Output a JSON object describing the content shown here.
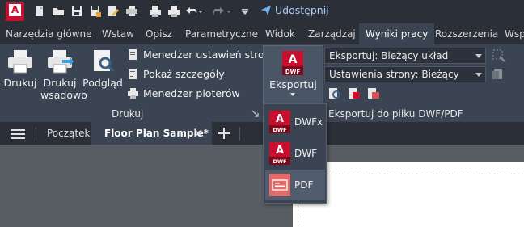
{
  "qat": {
    "share_label": "Udostępnij"
  },
  "tabs": [
    {
      "label": "Narzędzia główne",
      "active": false
    },
    {
      "label": "Wstaw",
      "active": false
    },
    {
      "label": "Opisz",
      "active": false
    },
    {
      "label": "Parametryczne",
      "active": false
    },
    {
      "label": "Widok",
      "active": false
    },
    {
      "label": "Zarządzaj",
      "active": false
    },
    {
      "label": "Wyniki pracy",
      "active": true
    },
    {
      "label": "Rozszerzenia",
      "active": false
    },
    {
      "label": "Wsp",
      "active": false
    }
  ],
  "ribbon": {
    "print_group": {
      "label": "Drukuj",
      "plot": "Drukuj",
      "batch_plot_line1": "Drukuj",
      "batch_plot_line2": "wsadowo",
      "preview": "Podgląd",
      "page_setup_manager": "Menedżer ustawień strony",
      "plot_details": "Pokaż szczegóły",
      "plotter_manager": "Menedżer ploterów"
    },
    "export_group": {
      "button_label": "Eksportuj",
      "export_combo_value": "Eksportuj: Bieżący układ",
      "page_setup_combo_value": "Ustawienia strony: Bieżący",
      "group_label": "Eksportuj do pliku DWF/PDF"
    }
  },
  "filetabs": {
    "start": "Początek",
    "active_file": "Floor Plan Sample*"
  },
  "export_menu": [
    {
      "label": "DWFx",
      "icon": "dwfx-file-icon",
      "selected": false
    },
    {
      "label": "DWF",
      "icon": "dwf-file-icon",
      "selected": false
    },
    {
      "label": "PDF",
      "icon": "pdf-file-icon",
      "selected": true
    }
  ],
  "icon_text": {
    "dwf": "DWF"
  },
  "colors": {
    "accent_red": "#c8102e",
    "ribbon_bg": "#3b4453",
    "titlebar_bg": "#2a2f38",
    "share_blue": "#a8cdf2"
  }
}
